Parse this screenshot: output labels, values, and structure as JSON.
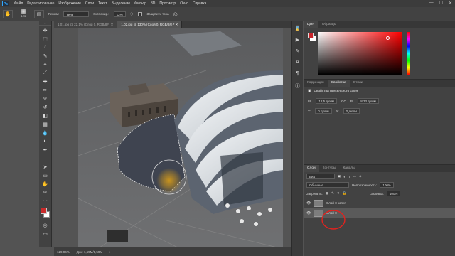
{
  "app": {
    "logo": "Ps"
  },
  "menu": [
    "Файл",
    "Редактирование",
    "Изображение",
    "Слои",
    "Текст",
    "Выделение",
    "Фильтр",
    "3D",
    "Просмотр",
    "Окно",
    "Справка"
  ],
  "window_controls": [
    "—",
    "☐",
    "✕"
  ],
  "options": {
    "brush_size": "125",
    "mode_label": "Режим:",
    "mode_value": "Тень",
    "exposure_label": "Экспонир.:",
    "exposure_value": "12%",
    "protect_tones": "Защитить тона"
  },
  "tabs": [
    {
      "label": "1.01.jpg @ 22,1% (Слой 0, RGB/8#)",
      "close": "✕"
    },
    {
      "label": "1.02.jpg @ 130% (Слой 0, RGB/8#) *",
      "close": "✕"
    }
  ],
  "status": {
    "zoom": "129,96%",
    "doc": "Док: 1,59М/1,59М"
  },
  "panels": {
    "color_tabs": [
      "Цвет",
      "Образцы"
    ],
    "props_tabs": [
      "Коррекция",
      "Свойства",
      "Стили"
    ],
    "props_title": "Свойства пиксельного слоя",
    "props_w_label": "Ш:",
    "props_w": "12,5 дюйм",
    "props_link": "GO",
    "props_h_label": "В:",
    "props_h": "8,33 дюйм",
    "props_x_label": "X:",
    "props_x": "0 дюйм",
    "props_y_label": "Y:",
    "props_y": "0 дюйм",
    "layers_tabs": [
      "Слои",
      "Контуры",
      "Каналы"
    ],
    "kind_label": "Вид",
    "blend_mode": "Обычные",
    "opacity_label": "Непрозрачность:",
    "opacity": "100%",
    "lock_label": "Закрепить:",
    "fill_label": "Заливка:",
    "fill": "100%",
    "layers": [
      "Слой 0 копия",
      "Слой 0"
    ]
  },
  "colors": {
    "foreground": "#c9242a",
    "annotation": "#e0231f"
  }
}
